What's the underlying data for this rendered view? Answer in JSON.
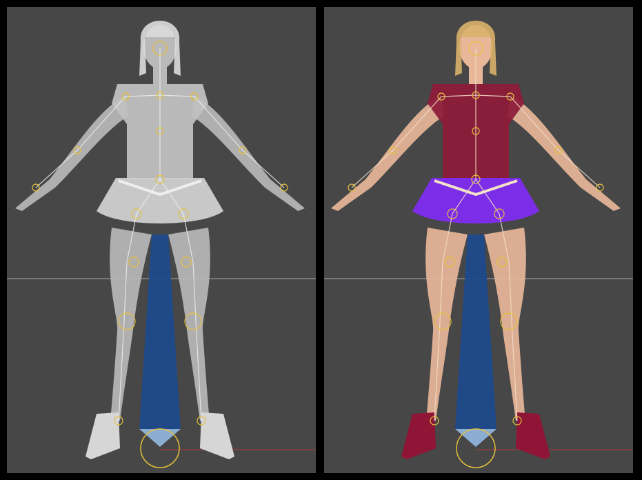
{
  "viewports": [
    {
      "id": "left",
      "shading": "wireframe-gray",
      "colors": {
        "skin": "#b9b9b9",
        "top": "#c2c2c2",
        "skirt": "#d0d0d0",
        "boots": "#d6d6d6",
        "hair": "#dcdcdc",
        "bone": "#eeeeee"
      }
    },
    {
      "id": "right",
      "shading": "textured",
      "colors": {
        "skin": "#e8b79a",
        "top": "#8e1b3a",
        "skirt": "#7f2cf1",
        "boots": "#8f1536",
        "hair": "#d9b16a",
        "bone": "#f2e0c8"
      }
    }
  ],
  "scene": {
    "background_color": "#474747",
    "ground_line_color": "#7a7a7a",
    "joint_color": "#e6c13a",
    "root_bone_color": "#1f4a8c",
    "root_bone_tip_color": "#8fb3d9",
    "axis_line_color": "#b33a3a"
  }
}
